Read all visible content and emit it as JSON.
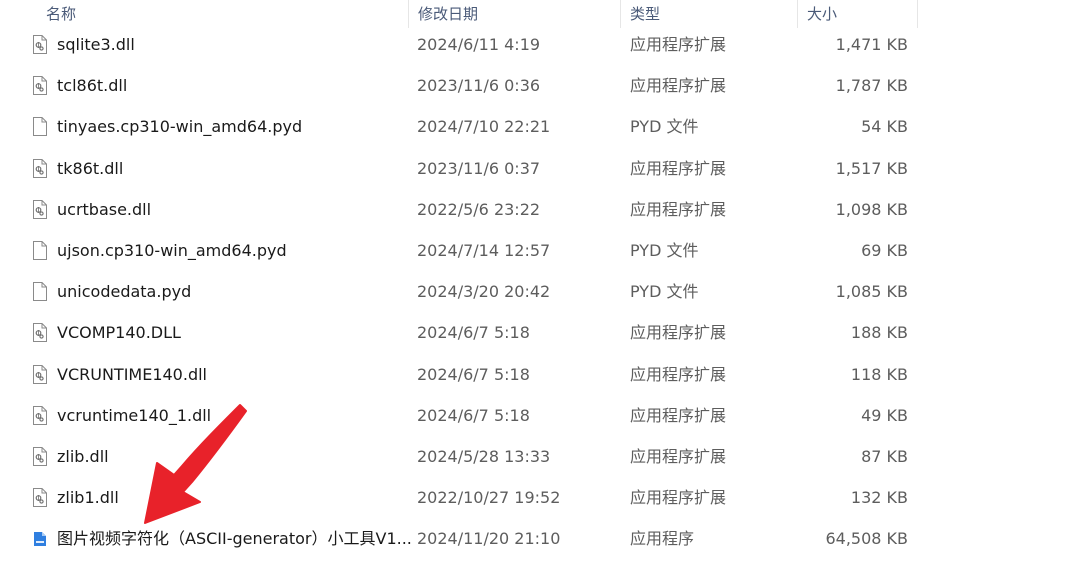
{
  "columns": {
    "name": "名称",
    "date": "修改日期",
    "type": "类型",
    "size": "大小"
  },
  "sort_indicator": "^",
  "files": [
    {
      "name": "sqlite3.dll",
      "date": "2024/6/11 4:19",
      "type": "应用程序扩展",
      "size": "1,471 KB",
      "icon": "dll-file-icon"
    },
    {
      "name": "tcl86t.dll",
      "date": "2023/11/6 0:36",
      "type": "应用程序扩展",
      "size": "1,787 KB",
      "icon": "dll-file-icon"
    },
    {
      "name": "tinyaes.cp310-win_amd64.pyd",
      "date": "2024/7/10 22:21",
      "type": "PYD 文件",
      "size": "54 KB",
      "icon": "blank-file-icon"
    },
    {
      "name": "tk86t.dll",
      "date": "2023/11/6 0:37",
      "type": "应用程序扩展",
      "size": "1,517 KB",
      "icon": "dll-file-icon"
    },
    {
      "name": "ucrtbase.dll",
      "date": "2022/5/6 23:22",
      "type": "应用程序扩展",
      "size": "1,098 KB",
      "icon": "dll-file-icon"
    },
    {
      "name": "ujson.cp310-win_amd64.pyd",
      "date": "2024/7/14 12:57",
      "type": "PYD 文件",
      "size": "69 KB",
      "icon": "blank-file-icon"
    },
    {
      "name": "unicodedata.pyd",
      "date": "2024/3/20 20:42",
      "type": "PYD 文件",
      "size": "1,085 KB",
      "icon": "blank-file-icon"
    },
    {
      "name": "VCOMP140.DLL",
      "date": "2024/6/7 5:18",
      "type": "应用程序扩展",
      "size": "188 KB",
      "icon": "dll-file-icon"
    },
    {
      "name": "VCRUNTIME140.dll",
      "date": "2024/6/7 5:18",
      "type": "应用程序扩展",
      "size": "118 KB",
      "icon": "dll-file-icon"
    },
    {
      "name": "vcruntime140_1.dll",
      "date": "2024/6/7 5:18",
      "type": "应用程序扩展",
      "size": "49 KB",
      "icon": "dll-file-icon"
    },
    {
      "name": "zlib.dll",
      "date": "2024/5/28 13:33",
      "type": "应用程序扩展",
      "size": "87 KB",
      "icon": "dll-file-icon"
    },
    {
      "name": "zlib1.dll",
      "date": "2022/10/27 19:52",
      "type": "应用程序扩展",
      "size": "132 KB",
      "icon": "dll-file-icon"
    },
    {
      "name": "图片视频字符化（ASCII-generator）小工具V1...",
      "date": "2024/11/20 21:10",
      "type": "应用程序",
      "size": "64,508 KB",
      "icon": "exe-app-icon"
    }
  ],
  "colors": {
    "header_text": "#4a5a78",
    "secondary_text": "#5d5d5d",
    "arrow": "#e8222a",
    "exe_icon": "#2f7fe0"
  }
}
